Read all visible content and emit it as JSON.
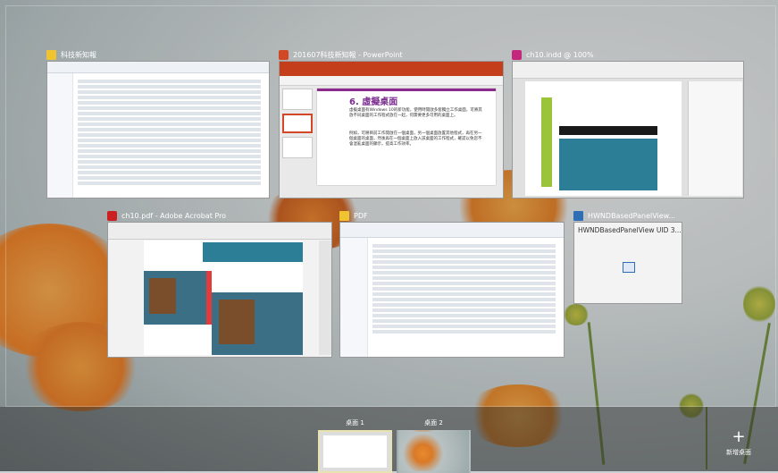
{
  "windows": [
    {
      "title": "科技新知報",
      "icon": "folder-icon",
      "icon_color": "#f0c330"
    },
    {
      "title": "201607科技新知報 - PowerPoint",
      "icon": "powerpoint-icon",
      "icon_color": "#d24726"
    },
    {
      "title": "ch10.indd @ 100%",
      "icon": "indesign-icon",
      "icon_color": "#c3287d"
    },
    {
      "title": "ch10.pdf - Adobe Acrobat Pro",
      "icon": "acrobat-icon",
      "icon_color": "#cc1f1f"
    },
    {
      "title": "PDF",
      "icon": "folder-icon",
      "icon_color": "#f0c330"
    },
    {
      "title": "HWNDBasedPanelView...",
      "icon": "generic-app-icon",
      "icon_color": "#2f6db5"
    }
  ],
  "slide": {
    "heading": "6. 虛擬桌面",
    "bullets": [
      "虛擬桌面有Windows 10的新功能，使用時開啟多套獨立工作桌面，可將其放不同桌面的工作程式放在一起，何需要更多可用的桌面上。",
      "例如，可將目前工作開啟在一個桌面，另一個桌面放置其他程式，再在另一個桌面的桌面，然後再在一個桌面上放入該桌面的工作程式，確認以免您不會混亂桌面的顯示，提高工作效率。"
    ]
  },
  "hwnd_panel": {
    "text": "HWNDBasedPanelView UID 3..."
  },
  "taskbar": {
    "desktops": [
      {
        "label": "桌面 1",
        "active": true
      },
      {
        "label": "桌面 2",
        "active": false
      }
    ],
    "new_desktop": {
      "icon": "plus-icon",
      "label": "新增桌面"
    }
  }
}
